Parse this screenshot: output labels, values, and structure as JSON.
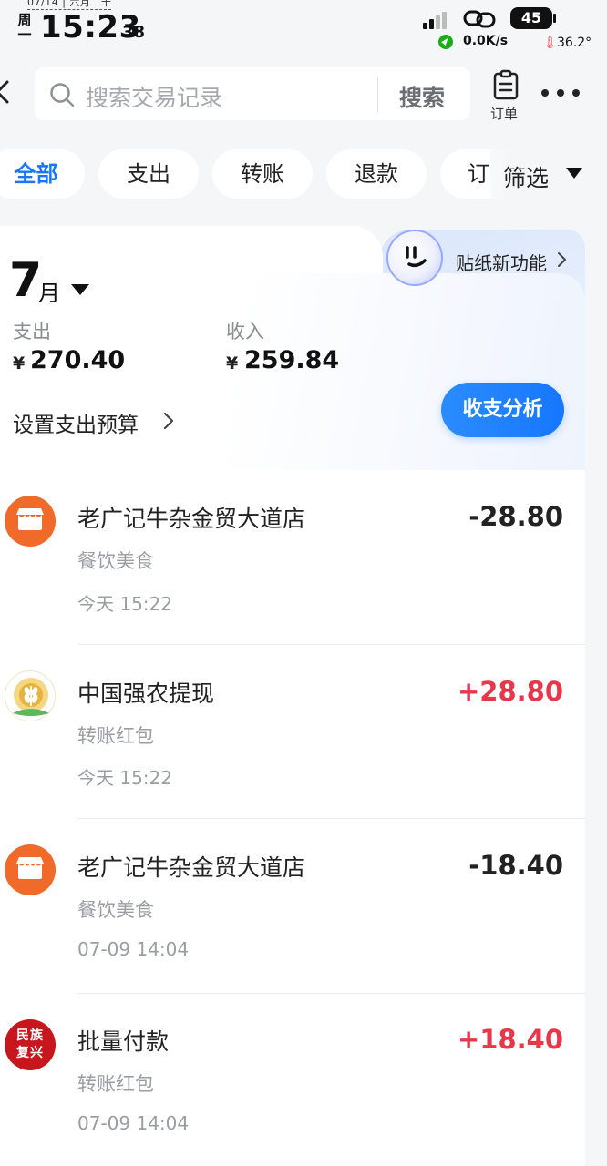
{
  "status_bar": {
    "date_partial": "07/14 | 六月二十",
    "weekday": "周一",
    "time": "15:23",
    "seconds": "38",
    "battery": "45",
    "net_speed": "0.0K/s",
    "temperature": "36.2°"
  },
  "header": {
    "search_placeholder": "搜索交易记录",
    "search_button": "搜索",
    "order_label": "订单"
  },
  "filters": {
    "chips": [
      "全部",
      "支出",
      "转账",
      "退款",
      "订"
    ],
    "active_index": 0,
    "filter_label": "筛选"
  },
  "summary": {
    "sticker_label": "贴纸新功能",
    "month_number": "7",
    "month_unit": "月",
    "expense_label": "支出",
    "expense_currency": "¥",
    "expense_value": "270.40",
    "income_label": "收入",
    "income_currency": "¥",
    "income_value": "259.84",
    "budget_label": "设置支出预算",
    "analysis_button": "收支分析"
  },
  "transactions": [
    {
      "title": "老广记牛杂金贸大道店",
      "category": "餐饮美食",
      "time": "今天 15:22",
      "amount": "-28.80",
      "logo": "shop-icon"
    },
    {
      "title": "中国强农提现",
      "category": "转账红包",
      "time": "今天 15:22",
      "amount": "+28.80",
      "logo": "wheat-icon"
    },
    {
      "title": "老广记牛杂金贸大道店",
      "category": "餐饮美食",
      "time": "07-09 14:04",
      "amount": "-18.40",
      "logo": "shop-icon"
    },
    {
      "title": "批量付款",
      "category": "转账红包",
      "time": "07-09 14:04",
      "amount": "+18.40",
      "logo": "minzu-fuxing-seal",
      "logo_text": "民族复兴"
    }
  ],
  "colors": {
    "accent": "#1677ff",
    "income": "#e8364a",
    "shop_logo": "#f06a2a",
    "seal_red": "#c8161e"
  }
}
